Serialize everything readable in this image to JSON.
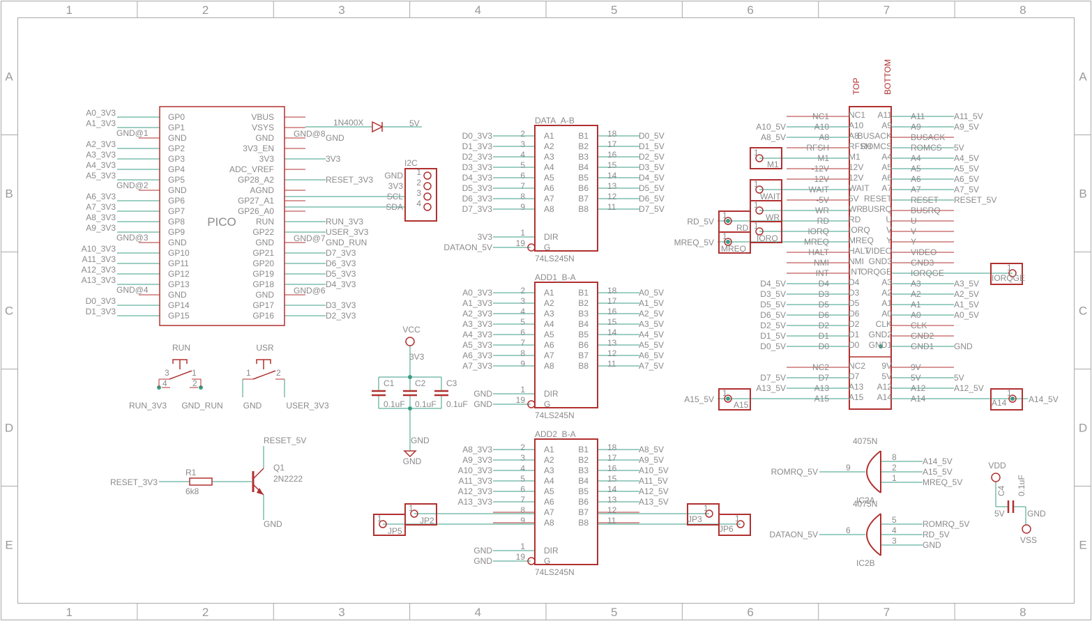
{
  "frame": {
    "columns": [
      "1",
      "2",
      "3",
      "4",
      "5",
      "6",
      "7",
      "8"
    ],
    "rows": [
      "A",
      "B",
      "C",
      "D",
      "E"
    ]
  },
  "pico": {
    "name": "PICO",
    "left_pins": [
      "GP0",
      "GP1",
      "GND",
      "GP2",
      "GP3",
      "GP4",
      "GP5",
      "GND",
      "GP6",
      "GP7",
      "GP8",
      "GP9",
      "GND",
      "GP10",
      "GP11",
      "GP12",
      "GP13",
      "GND",
      "GP14",
      "GP15"
    ],
    "right_pins": [
      "VBUS",
      "VSYS",
      "GND",
      "3V3_EN",
      "3V3",
      "ADC_VREF",
      "GP28_A2",
      "AGND",
      "GP27_A1",
      "GP26_A0",
      "RUN",
      "GP22",
      "GND",
      "GP21",
      "GP20",
      "GP19",
      "GP18",
      "GND",
      "GP17",
      "GP16"
    ],
    "left_nets": [
      "A0_3V3",
      "A1_3V3",
      "",
      "A2_3V3",
      "A3_3V3",
      "A4_3V3",
      "A5_3V3",
      "",
      "A6_3V3",
      "A7_3V3",
      "A8_3V3",
      "A9_3V3",
      "",
      "A10_3V3",
      "A11_3V3",
      "A12_3V3",
      "A13_3V3",
      "",
      "D0_3V3",
      "D1_3V3"
    ],
    "left_gnd_labels": [
      "GND@1",
      "GND@2",
      "GND@3",
      "GND@4"
    ],
    "right_nets": [
      "",
      "",
      "GND",
      "",
      "3V3",
      "",
      "RESET_3V3",
      "",
      "",
      "",
      "RUN_3V3",
      "USER_3V3",
      "GND_RUN",
      "D7_3V3",
      "D6_3V3",
      "D5_3V3",
      "D4_3V3",
      "",
      "D3_3V3",
      "D2_3V3"
    ],
    "right_gnd_labels": [
      "GND@8",
      "GND@7",
      "GND@6"
    ],
    "diode": "1N400X",
    "diode_net": "5V"
  },
  "i2c": {
    "title": "I2C",
    "pins": [
      "GND",
      "3V3",
      "SCL",
      "SDA"
    ],
    "numbers": [
      "1",
      "2",
      "3",
      "4"
    ]
  },
  "buffers": [
    {
      "name": "DATA_A-B",
      "part": "74LS245N",
      "a_pins": [
        "A1",
        "A2",
        "A3",
        "A4",
        "A5",
        "A6",
        "A7",
        "A8"
      ],
      "b_pins": [
        "B1",
        "B2",
        "B3",
        "B4",
        "B5",
        "B6",
        "B7",
        "B8"
      ],
      "a_nums": [
        "2",
        "3",
        "4",
        "5",
        "6",
        "7",
        "8",
        "9"
      ],
      "b_nums": [
        "18",
        "17",
        "16",
        "15",
        "14",
        "13",
        "12",
        "11"
      ],
      "left_nets": [
        "D0_3V3",
        "D1_3V3",
        "D2_3V3",
        "D3_3V3",
        "D4_3V3",
        "D5_3V3",
        "D6_3V3",
        "D7_3V3"
      ],
      "right_nets": [
        "D0_5V",
        "D1_5V",
        "D2_5V",
        "D3_5V",
        "D4_5V",
        "D5_5V",
        "D6_5V",
        "D7_5V"
      ],
      "dir_label": "DIR",
      "g_label": "G",
      "dir_num": "1",
      "g_num": "19",
      "dir_net": "3V3",
      "g_net": "DATAON_5V"
    },
    {
      "name": "ADD1_B-A",
      "part": "74LS245N",
      "a_pins": [
        "A1",
        "A2",
        "A3",
        "A4",
        "A5",
        "A6",
        "A7",
        "A8"
      ],
      "b_pins": [
        "B1",
        "B2",
        "B3",
        "B4",
        "B5",
        "B6",
        "B7",
        "B8"
      ],
      "a_nums": [
        "2",
        "3",
        "4",
        "5",
        "6",
        "7",
        "8",
        "9"
      ],
      "b_nums": [
        "18",
        "17",
        "16",
        "15",
        "14",
        "13",
        "12",
        "11"
      ],
      "left_nets": [
        "A0_3V3",
        "A1_3V3",
        "A2_3V3",
        "A3_3V3",
        "A4_3V3",
        "A5_3V3",
        "A6_3V3",
        "A7_3V3"
      ],
      "right_nets": [
        "A0_5V",
        "A1_5V",
        "A2_5V",
        "A3_5V",
        "A4_5V",
        "A5_5V",
        "A6_5V",
        "A7_5V"
      ],
      "dir_label": "DIR",
      "g_label": "G",
      "dir_num": "1",
      "g_num": "19",
      "dir_net": "GND",
      "g_net": "GND"
    },
    {
      "name": "ADD2_B-A",
      "part": "74LS245N",
      "a_pins": [
        "A1",
        "A2",
        "A3",
        "A4",
        "A5",
        "A6",
        "A7",
        "A8"
      ],
      "b_pins": [
        "B1",
        "B2",
        "B3",
        "B4",
        "B5",
        "B6",
        "B7",
        "B8"
      ],
      "a_nums": [
        "2",
        "3",
        "4",
        "5",
        "6",
        "7",
        "8",
        "9"
      ],
      "b_nums": [
        "18",
        "17",
        "16",
        "15",
        "14",
        "13",
        "12",
        "11"
      ],
      "left_nets": [
        "A8_3V3",
        "A9_3V3",
        "A10_3V3",
        "A11_3V3",
        "A12_3V3",
        "A13_3V3",
        "",
        ""
      ],
      "right_nets": [
        "A8_5V",
        "A9_5V",
        "A10_5V",
        "A11_5V",
        "A12_5V",
        "A13_5V",
        "",
        ""
      ],
      "dir_label": "DIR",
      "g_label": "G",
      "dir_num": "1",
      "g_num": "19",
      "dir_net": "GND",
      "g_net": "GND"
    }
  ],
  "edge": {
    "top_label": "TOP",
    "bottom_label": "BOTTOM",
    "rows": [
      {
        "lnet": "",
        "lpin": "NC1",
        "tp": "NC1",
        "bp": "A11",
        "rpin": "A11",
        "rnet": "A11_5V"
      },
      {
        "lnet": "A10_5V",
        "lpin": "A10",
        "tp": "A10",
        "bp": "A9",
        "rpin": "A9",
        "rnet": "A9_5V"
      },
      {
        "lnet": "A8_5V",
        "lpin": "A8",
        "tp": "A8",
        "bp": "BUSACK",
        "rpin": "BUSACK",
        "rnet": ""
      },
      {
        "lnet": "",
        "lpin": "RFSH",
        "tp": "RFSH",
        "bp": "ROMCS",
        "rpin": "ROMCS",
        "rnet": "5V"
      },
      {
        "lnet": "",
        "lpin": "M1",
        "tp": "M1",
        "bp": "A4",
        "rpin": "A4",
        "rnet": "A4_5V"
      },
      {
        "lnet": "",
        "lpin": "-12V",
        "tp": "12V",
        "bp": "A5",
        "rpin": "A5",
        "rnet": "A5_5V"
      },
      {
        "lnet": "",
        "lpin": "12V",
        "tp": "12V",
        "bp": "A6",
        "rpin": "A6",
        "rnet": "A6_5V"
      },
      {
        "lnet": "",
        "lpin": "WAIT",
        "tp": "WAIT",
        "bp": "A7",
        "rpin": "A7",
        "rnet": "A7_5V"
      },
      {
        "lnet": "",
        "lpin": "-5V",
        "tp": "5V",
        "bp": "RESET",
        "rpin": "RESET",
        "rnet": "RESET_5V"
      },
      {
        "lnet": "",
        "lpin": "WR",
        "tp": "WR",
        "bp": "BUSRQ",
        "rpin": "BUSRQ",
        "rnet": ""
      },
      {
        "lnet": "",
        "lpin": "RD",
        "tp": "RD",
        "bp": "U",
        "rpin": "U",
        "rnet": ""
      },
      {
        "lnet": "",
        "lpin": "IORQ",
        "tp": "IORQ",
        "bp": "V",
        "rpin": "V",
        "rnet": ""
      },
      {
        "lnet": "",
        "lpin": "MREQ",
        "tp": "MREQ",
        "bp": "Y",
        "rpin": "Y",
        "rnet": ""
      },
      {
        "lnet": "",
        "lpin": "HALT",
        "tp": "HALT",
        "bp": "VIDEO",
        "rpin": "VIDEO",
        "rnet": ""
      },
      {
        "lnet": "",
        "lpin": "NMI",
        "tp": "NMI",
        "bp": "GND3",
        "rpin": "GND3",
        "rnet": ""
      },
      {
        "lnet": "",
        "lpin": "INT",
        "tp": "INT",
        "bp": "IORQGE",
        "rpin": "IORQGE",
        "rnet": ""
      },
      {
        "lnet": "D4_5V",
        "lpin": "D4",
        "tp": "D4",
        "bp": "A3",
        "rpin": "A3",
        "rnet": "A3_5V"
      },
      {
        "lnet": "D3_5V",
        "lpin": "D3",
        "tp": "D3",
        "bp": "A2",
        "rpin": "A2",
        "rnet": "A2_5V"
      },
      {
        "lnet": "D5_5V",
        "lpin": "D5",
        "tp": "D5",
        "bp": "A1",
        "rpin": "A1",
        "rnet": "A1_5V"
      },
      {
        "lnet": "D6_5V",
        "lpin": "D6",
        "tp": "D6",
        "bp": "A0",
        "rpin": "A0",
        "rnet": "A0_5V"
      },
      {
        "lnet": "D2_5V",
        "lpin": "D2",
        "tp": "D2",
        "bp": "CLK",
        "rpin": "CLK",
        "rnet": ""
      },
      {
        "lnet": "D1_5V",
        "lpin": "D1",
        "tp": "D1",
        "bp": "GND2",
        "rpin": "GND2",
        "rnet": ""
      },
      {
        "lnet": "D0_5V",
        "lpin": "D0",
        "tp": "D0",
        "bp": "GND1",
        "rpin": "GND1",
        "rnet": "GND"
      },
      {
        "lnet": "",
        "lpin": "",
        "tp": "",
        "bp": "",
        "rpin": "",
        "rnet": ""
      },
      {
        "lnet": "",
        "lpin": "NC2",
        "tp": "NC2",
        "bp": "9V",
        "rpin": "9V",
        "rnet": ""
      },
      {
        "lnet": "D7_5V",
        "lpin": "D7",
        "tp": "D7",
        "bp": "5V",
        "rpin": "5V",
        "rnet": "5V"
      },
      {
        "lnet": "A13_5V",
        "lpin": "A13",
        "tp": "A13",
        "bp": "A12",
        "rpin": "A12",
        "rnet": "A12_5V"
      },
      {
        "lnet": "",
        "lpin": "A15",
        "tp": "A15",
        "bp": "A14",
        "rpin": "A14",
        "rnet": ""
      }
    ]
  },
  "jumpers": {
    "m1": {
      "name": "M1",
      "pin": "1"
    },
    "wait": {
      "name": "WAIT",
      "pin": "1"
    },
    "wr": {
      "name": "WR",
      "pin": "1"
    },
    "iorq": {
      "name": "IORQ",
      "pin": "1"
    },
    "rd": {
      "name": "RD",
      "pin": "1",
      "net": "RD_5V"
    },
    "mreq": {
      "name": "MREQ",
      "pin": "1",
      "net": "MREQ_5V"
    },
    "iorqge": {
      "name": "IORQGE",
      "pin": "1"
    },
    "a15": {
      "name": "A15",
      "pin": "1",
      "net": "A15_5V"
    },
    "a14": {
      "name": "A14",
      "pin": "1",
      "net": "A14_5V"
    },
    "jp5": {
      "name": "JP5",
      "pin": "1"
    },
    "jp2": {
      "name": "JP2",
      "pin": "1"
    },
    "jp3": {
      "name": "JP3",
      "pin": "1"
    },
    "jp6": {
      "name": "JP6",
      "pin": "1"
    }
  },
  "buttons": {
    "run": {
      "name": "RUN",
      "nets": [
        "RUN_3V3",
        "GND_RUN"
      ],
      "pins": [
        "3",
        "1",
        "4",
        "2"
      ]
    },
    "usr": {
      "name": "USR",
      "nets": [
        "GND",
        "USER_3V3"
      ],
      "pins": [
        "1",
        "2"
      ]
    }
  },
  "caps": {
    "vcc": "VCC",
    "net": "3V3",
    "gnd_net": "GND",
    "gnd_symbol": "GND",
    "names": [
      "C1",
      "C2",
      "C3"
    ],
    "values": [
      "0.1uF",
      "0.1uF",
      "0.1uF"
    ]
  },
  "transistor": {
    "name": "Q1",
    "part": "2N2222",
    "collector_net": "RESET_5V",
    "emitter_net": "GND",
    "input_net": "RESET_3V3",
    "resistor_name": "R1",
    "resistor_value": "6k8"
  },
  "gates": [
    {
      "part": "4075N",
      "name": "IC2A",
      "in_pins": [
        "8",
        "2",
        "1"
      ],
      "out_pin": "9",
      "in_nets": [
        "A14_5V",
        "A15_5V",
        "MREQ_5V"
      ],
      "out_net": "ROMRQ_5V"
    },
    {
      "part": "4075N",
      "name": "IC2B",
      "in_pins": [
        "5",
        "4",
        "3"
      ],
      "out_pin": "6",
      "in_nets": [
        "ROMRQ_5V",
        "RD_5V",
        "GND"
      ],
      "out_net": "DATAON_5V"
    }
  ],
  "cap4": {
    "name": "C4",
    "value": "0.1uF",
    "top": "VDD",
    "bottom": "VSS",
    "left_net": "5V",
    "right_net": "GND"
  }
}
